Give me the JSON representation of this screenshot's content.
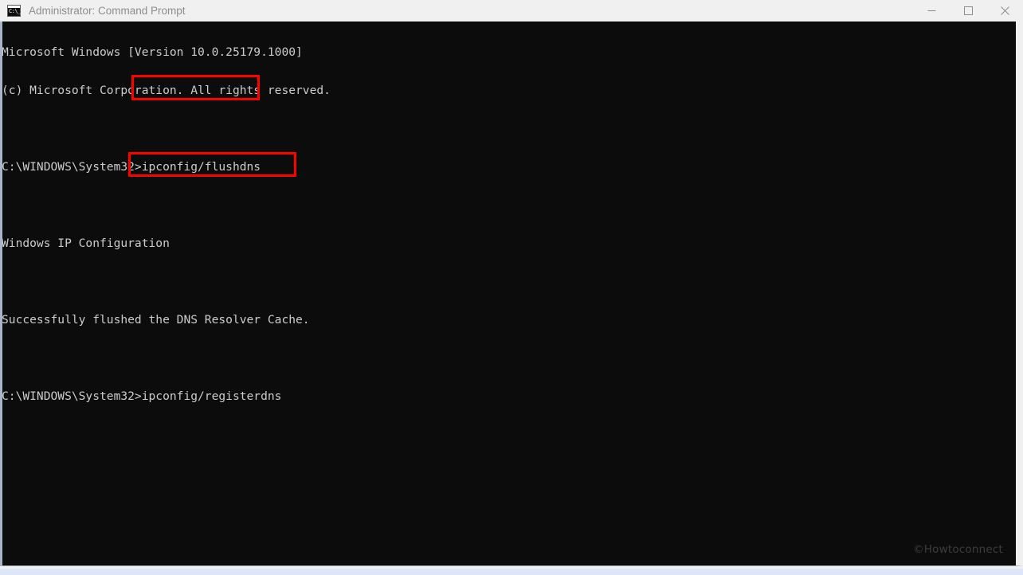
{
  "window": {
    "title": "Administrator: Command Prompt",
    "icon_name": "command-prompt-icon",
    "icon_glyph": "C:\\_",
    "controls": {
      "minimize_label": "Minimize",
      "maximize_label": "Maximize",
      "close_label": "Close"
    },
    "colors": {
      "titlebar_bg": "#f0f0f0",
      "title_fg": "#8d8d8d",
      "console_bg": "#0c0c0c",
      "console_fg": "#cccccc",
      "annotation": "#ff0000",
      "desktop": "#dce6f7"
    }
  },
  "console": {
    "lines": [
      "Microsoft Windows [Version 10.0.25179.1000]",
      "(c) Microsoft Corporation. All rights reserved.",
      "",
      "C:\\WINDOWS\\System32>ipconfig/flushdns",
      "",
      "Windows IP Configuration",
      "",
      "Successfully flushed the DNS Resolver Cache.",
      "",
      "C:\\WINDOWS\\System32>ipconfig/registerdns"
    ],
    "prompt_path": "C:\\WINDOWS\\System32>",
    "commands": [
      "ipconfig/flushdns",
      "ipconfig/registerdns"
    ]
  },
  "annotations": [
    {
      "name": "highlight-flushdns-command",
      "text": "ipconfig/flushdns"
    },
    {
      "name": "highlight-registerdns-command",
      "text": "ipconfig/registerdns"
    }
  ],
  "watermark": {
    "text": "©Howtoconnect"
  }
}
